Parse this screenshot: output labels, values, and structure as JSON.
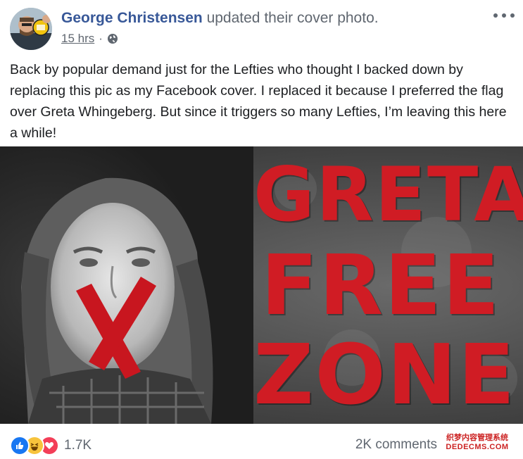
{
  "post": {
    "author": "George Christensen",
    "action": "updated their cover photo.",
    "time": "15 hrs",
    "separator": "·",
    "privacy_icon": "globe-icon",
    "more_icon": "more-options-icon",
    "text": "Back by popular demand just for the Lefties who thought I backed down by replacing this pic as my Facebook cover. I replaced it because I preferred the flag over Greta Whingeberg. But since it triggers so many Lefties, I’m leaving this here a while!"
  },
  "image": {
    "line1": "GRETA",
    "line2": "FREE",
    "line3": "ZONE"
  },
  "footer": {
    "reaction_icons": [
      "like-icon",
      "haha-icon",
      "love-icon"
    ],
    "reaction_count": "1.7K",
    "comments": "2K comments"
  },
  "watermark": {
    "line1": "织梦内容管理系统",
    "line2": "DEDECMS.COM"
  },
  "colors": {
    "author": "#385898",
    "secondary_text": "#606770",
    "image_text": "#d01c24",
    "like": "#1877f2",
    "haha": "#f7c33c",
    "love": "#f33e58"
  }
}
